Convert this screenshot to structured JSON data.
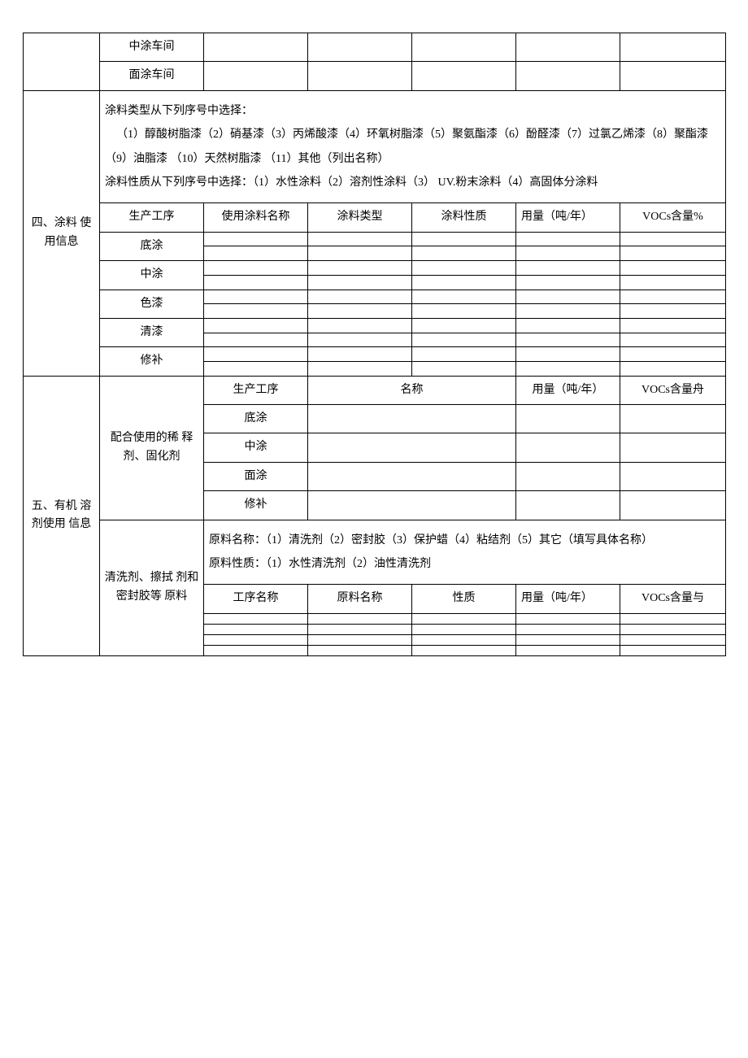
{
  "top_rows": {
    "row1_label": "中涂车间",
    "row2_label": "面涂车间"
  },
  "section4": {
    "title": "四、涂料 使用信息",
    "notes_line1": "涂料类型从下列序号中选择：",
    "notes_line2": "（1）醇酸树脂漆（2）硝基漆（3）丙烯酸漆（4）环氧树脂漆（5）聚氨酯漆（6）酚醛漆（7）过氯乙烯漆（8）聚酯漆 （9）油脂漆 （10）天然树脂漆 （11）其他（列出名称）",
    "notes_line3": "涂料性质从下列序号中选择：（1）水性涂料（2）溶剂性涂料（3） UV.粉末涂料（4）高固体分涂料",
    "headers": {
      "h1": "生产工序",
      "h2": "使用涂料名称",
      "h3": "涂料类型",
      "h4": "涂料性质",
      "h5": "用量（吨/年）",
      "h6": "VOCs含量%"
    },
    "rows": {
      "r1": "底涂",
      "r2": "中涂",
      "r3": "色漆",
      "r4": "清漆",
      "r5": "修补"
    }
  },
  "section5": {
    "title": "五、有机 溶剂使用 信息",
    "group1_label": "配合使用的稀 释剂、固化剂",
    "group1_headers": {
      "h1": "生产工序",
      "h2": "名称",
      "h3": "用量（吨/年）",
      "h4": "VOCs含量舟"
    },
    "group1_rows": {
      "r1": "底涂",
      "r2": "中涂",
      "r3": "面涂",
      "r4": "修补"
    },
    "group2_label": "清洗剂、擦拭 剂和密封胶等 原料",
    "group2_notes_line1": "原料名称：（1）清洗剂（2）密封胶（3）保护蜡（4）粘结剂（5）其它（填写具体名称）",
    "group2_notes_line2": "原料性质：（1）水性清洗剂（2）油性清洗剂",
    "group2_headers": {
      "h1": "工序名称",
      "h2": "原料名称",
      "h3": "性质",
      "h4": "用量（吨/年）",
      "h5": "VOCs含量与"
    }
  }
}
